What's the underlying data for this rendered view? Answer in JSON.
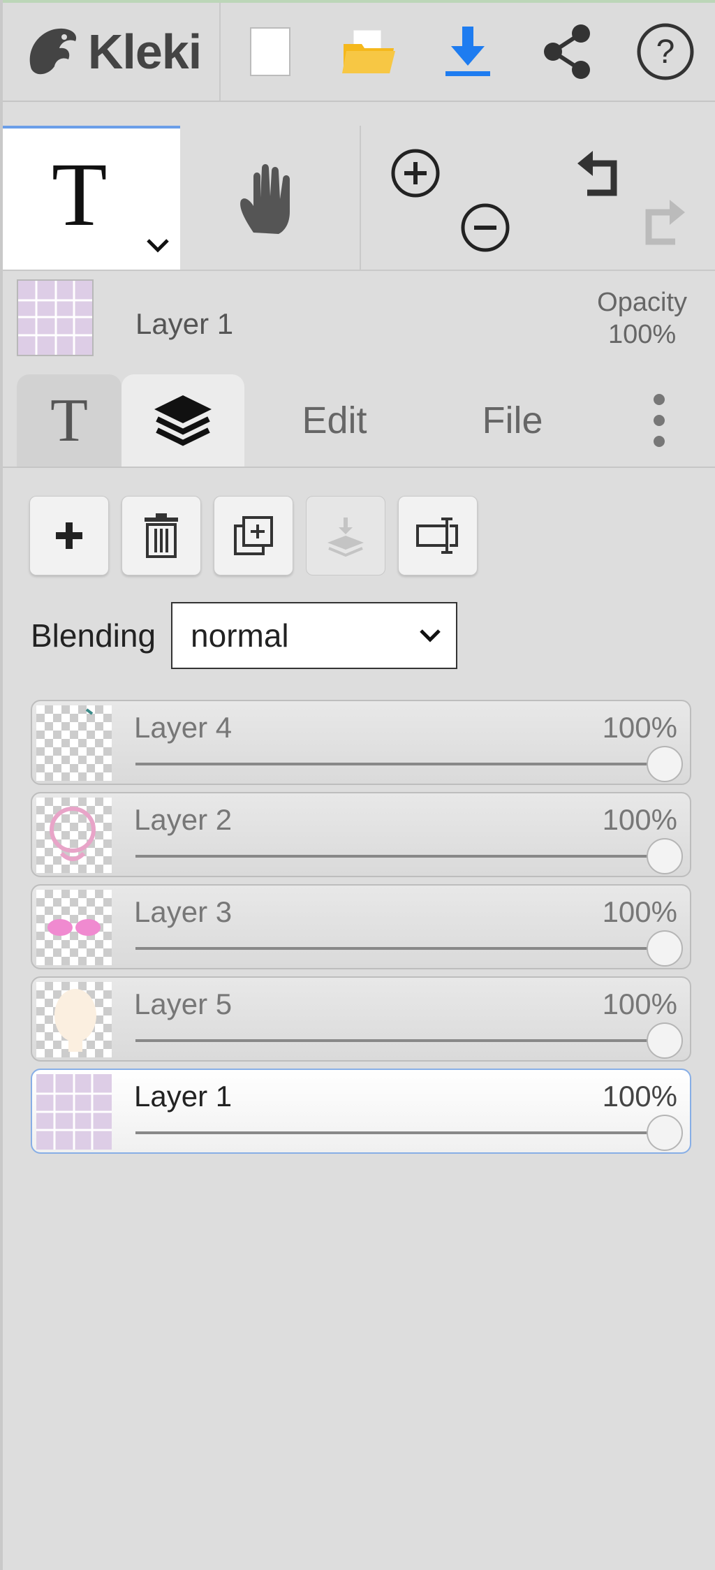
{
  "app": {
    "name": "Kleki"
  },
  "top_bar": {
    "icons": [
      "new-document-icon",
      "open-folder-icon",
      "download-icon",
      "share-icon",
      "help-icon"
    ],
    "accent_color": "#1e7cf0",
    "folder_color": "#f5b81c"
  },
  "tools": {
    "active_tool_glyph": "T",
    "items": [
      "text-tool",
      "hand-tool",
      "zoom-in",
      "zoom-out",
      "undo",
      "redo"
    ]
  },
  "current_layer": {
    "name": "Layer 1",
    "opacity_label": "Opacity",
    "opacity_value": "100%"
  },
  "tabs": [
    {
      "label": "T",
      "icon": "text-icon"
    },
    {
      "label": "",
      "icon": "layers-icon"
    },
    {
      "label": "Edit"
    },
    {
      "label": "File"
    },
    {
      "label": "⋮",
      "icon": "more-icon"
    }
  ],
  "layer_actions": [
    "add-layer",
    "delete-layer",
    "duplicate-layer",
    "merge-down",
    "rename-layer"
  ],
  "blending": {
    "label": "Blending",
    "value": "normal"
  },
  "layers": [
    {
      "name": "Layer 4",
      "opacity": "100%",
      "opacity_fraction": 1.0,
      "selected": false
    },
    {
      "name": "Layer 2",
      "opacity": "100%",
      "opacity_fraction": 1.0,
      "selected": false
    },
    {
      "name": "Layer 3",
      "opacity": "100%",
      "opacity_fraction": 1.0,
      "selected": false
    },
    {
      "name": "Layer 5",
      "opacity": "100%",
      "opacity_fraction": 1.0,
      "selected": false
    },
    {
      "name": "Layer 1",
      "opacity": "100%",
      "opacity_fraction": 1.0,
      "selected": true
    }
  ]
}
